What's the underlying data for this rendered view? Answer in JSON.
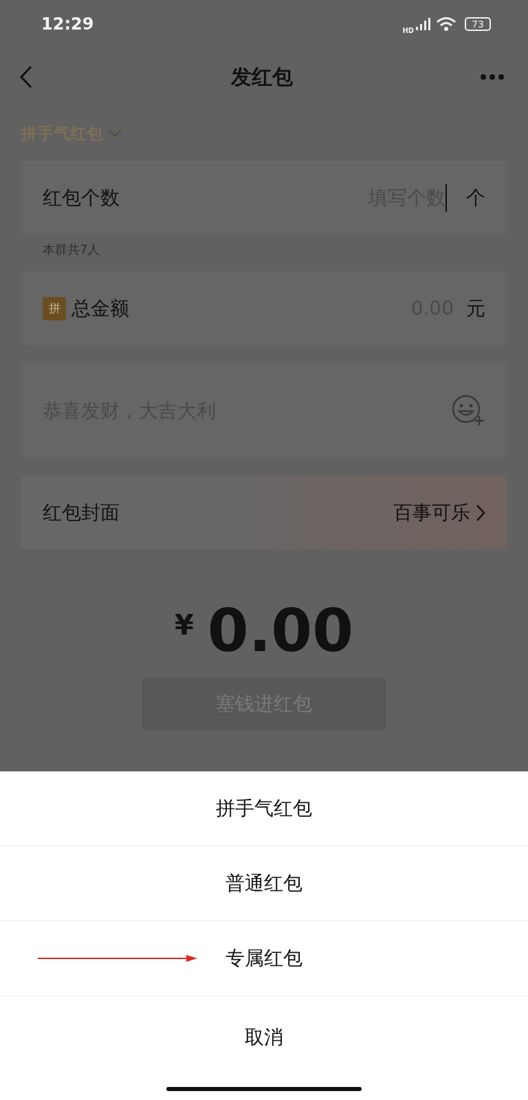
{
  "status_bar": {
    "time": "12:29",
    "network": "HD",
    "battery": "73"
  },
  "nav": {
    "title": "发红包"
  },
  "packet_type": {
    "label": "拼手气红包"
  },
  "count_field": {
    "label": "红包个数",
    "placeholder": "填写个数",
    "unit": "个"
  },
  "group_note": "本群共7人",
  "amount_field": {
    "badge": "拼",
    "label": "总金额",
    "placeholder": "0.00",
    "unit": "元"
  },
  "greeting_field": {
    "placeholder": "恭喜发财，大吉大利"
  },
  "cover_row": {
    "label": "红包封面",
    "value": "百事可乐"
  },
  "total": {
    "currency": "¥",
    "amount": "0.00"
  },
  "submit_button": {
    "label": "塞钱进红包",
    "disabled": true
  },
  "action_sheet": {
    "options": [
      {
        "label": "拼手气红包",
        "highlighted": false
      },
      {
        "label": "普通红包",
        "highlighted": false
      },
      {
        "label": "专属红包",
        "highlighted": true
      }
    ],
    "cancel": "取消"
  }
}
